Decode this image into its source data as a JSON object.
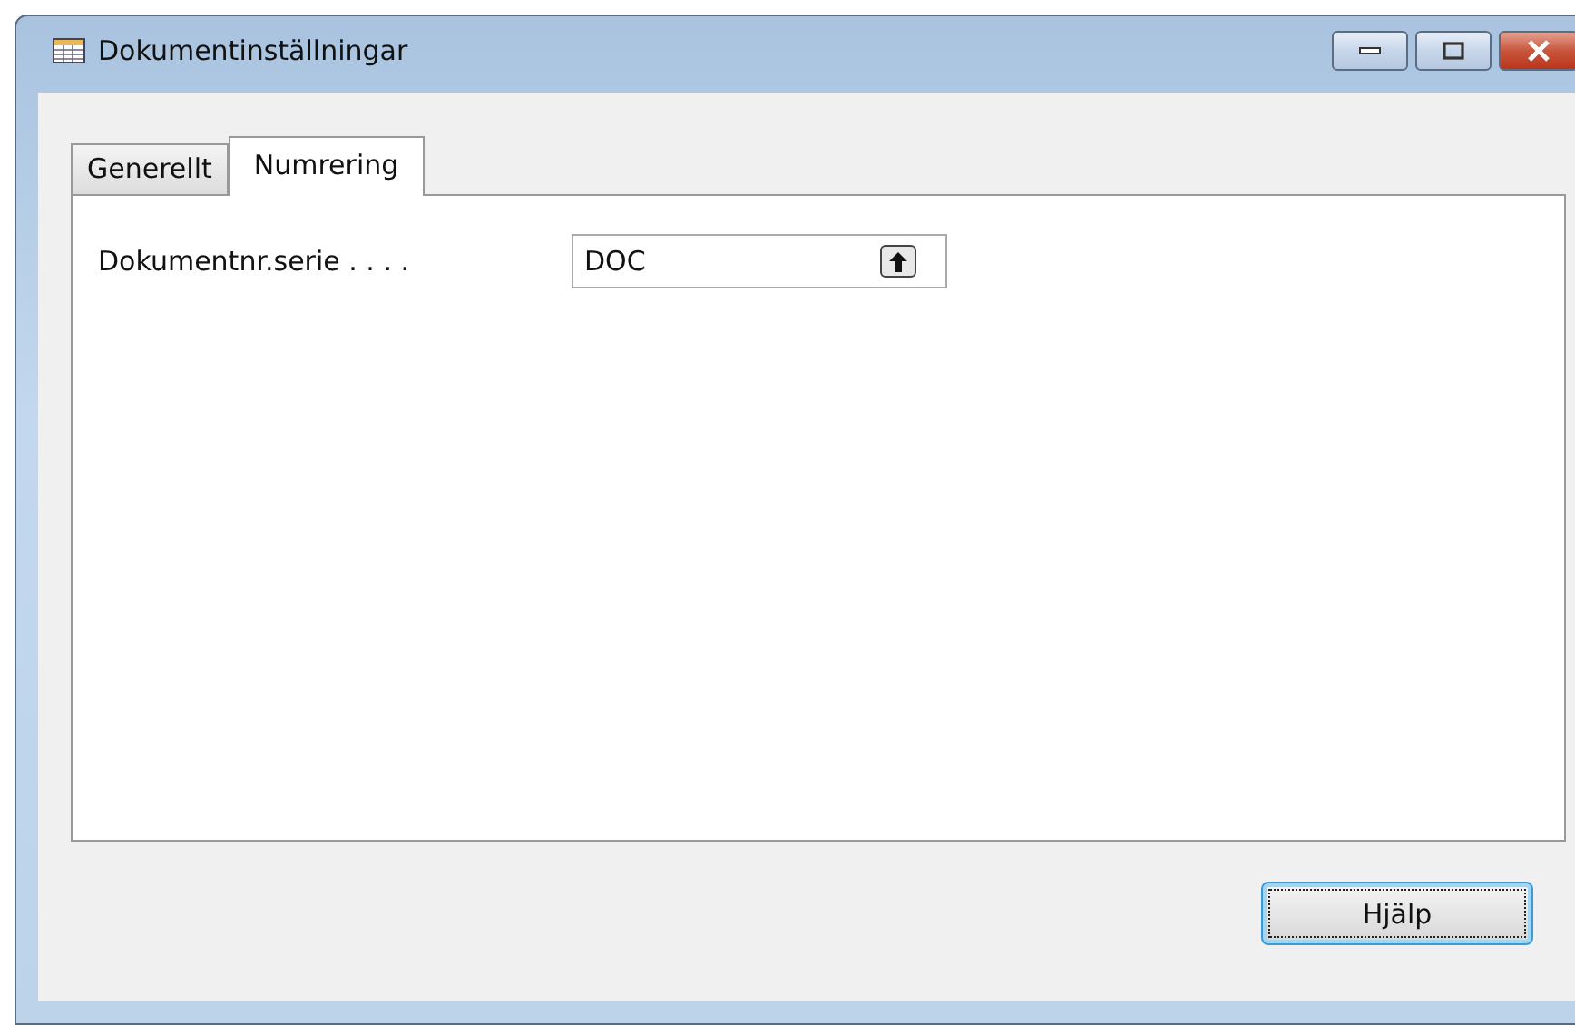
{
  "window": {
    "title": "Dokumentinställningar"
  },
  "tabs": [
    {
      "label": "Generellt",
      "selected": false
    },
    {
      "label": "Numrering",
      "selected": true
    }
  ],
  "fields": [
    {
      "label": "Dokumentnr.serie . . . .",
      "value": "DOC"
    }
  ],
  "buttons": [
    {
      "label": "Hjälp",
      "focused": true
    }
  ]
}
